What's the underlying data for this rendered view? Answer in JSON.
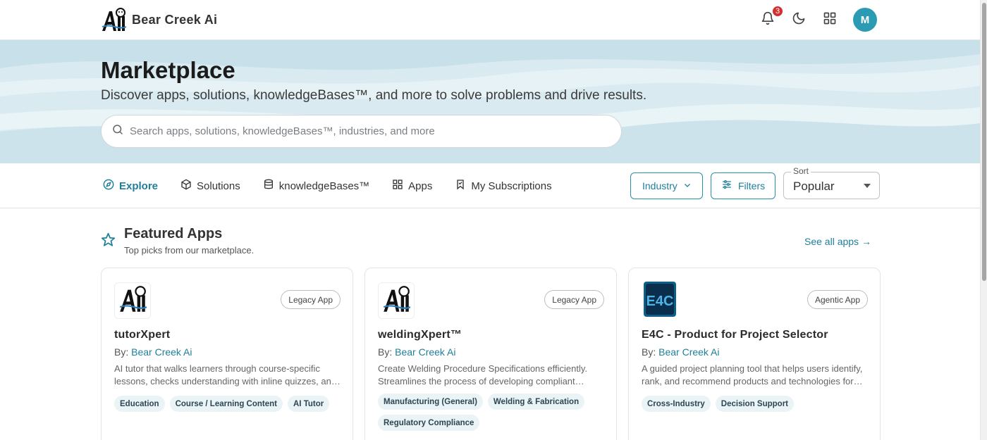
{
  "brand": {
    "name": "Bear Creek Ai",
    "logo_icon": "bear-logo-icon"
  },
  "header": {
    "notification_count": "3",
    "avatar_initial": "M"
  },
  "hero": {
    "title": "Marketplace",
    "subtitle": "Discover apps, solutions, knowledgeBases™, and more to solve problems and drive results.",
    "search_placeholder": "Search apps, solutions, knowledgeBases™, industries, and more"
  },
  "nav": {
    "tabs": [
      {
        "label": "Explore",
        "icon": "compass-icon",
        "active": true
      },
      {
        "label": "Solutions",
        "icon": "cube-icon"
      },
      {
        "label": "knowledgeBases™",
        "icon": "database-icon"
      },
      {
        "label": "Apps",
        "icon": "grid-icon"
      },
      {
        "label": "My Subscriptions",
        "icon": "bookmark-icon"
      }
    ],
    "industry_label": "Industry",
    "filters_label": "Filters",
    "sort_label": "Sort",
    "sort_value": "Popular"
  },
  "featured": {
    "title": "Featured Apps",
    "subtitle": "Top picks from our marketplace.",
    "see_all": "See all apps →"
  },
  "cards": [
    {
      "badge": "Legacy App",
      "title": "tutorXpert",
      "by_prefix": "By:",
      "by_name": "Bear Creek Ai",
      "description": "AI tutor that walks learners through course-specific lessons, checks understanding with inline quizzes, and adapts to each learner.",
      "tags": [
        "Education",
        "Course / Learning Content",
        "AI Tutor"
      ]
    },
    {
      "badge": "Legacy App",
      "title": "weldingXpert™",
      "by_prefix": "By:",
      "by_name": "Bear Creek Ai",
      "description": "Create Welding Procedure Specifications efficiently. Streamlines the process of developing compliant documentation.",
      "tags": [
        "Manufacturing (General)",
        "Welding & Fabrication",
        "Regulatory Compliance"
      ]
    },
    {
      "badge": "Agentic App",
      "title": "E4C - Product for Project Selector",
      "by_prefix": "By:",
      "by_name": "Bear Creek Ai",
      "description": "A guided project planning tool that helps users identify, rank, and recommend products and technologies for their projects.",
      "tags": [
        "Cross-Industry",
        "Decision Support"
      ]
    }
  ],
  "colors": {
    "accent": "#1e7f9b",
    "avatar": "#2a9bb3",
    "badge": "#d32f2f",
    "hero_bg": "#d9ebf1"
  }
}
